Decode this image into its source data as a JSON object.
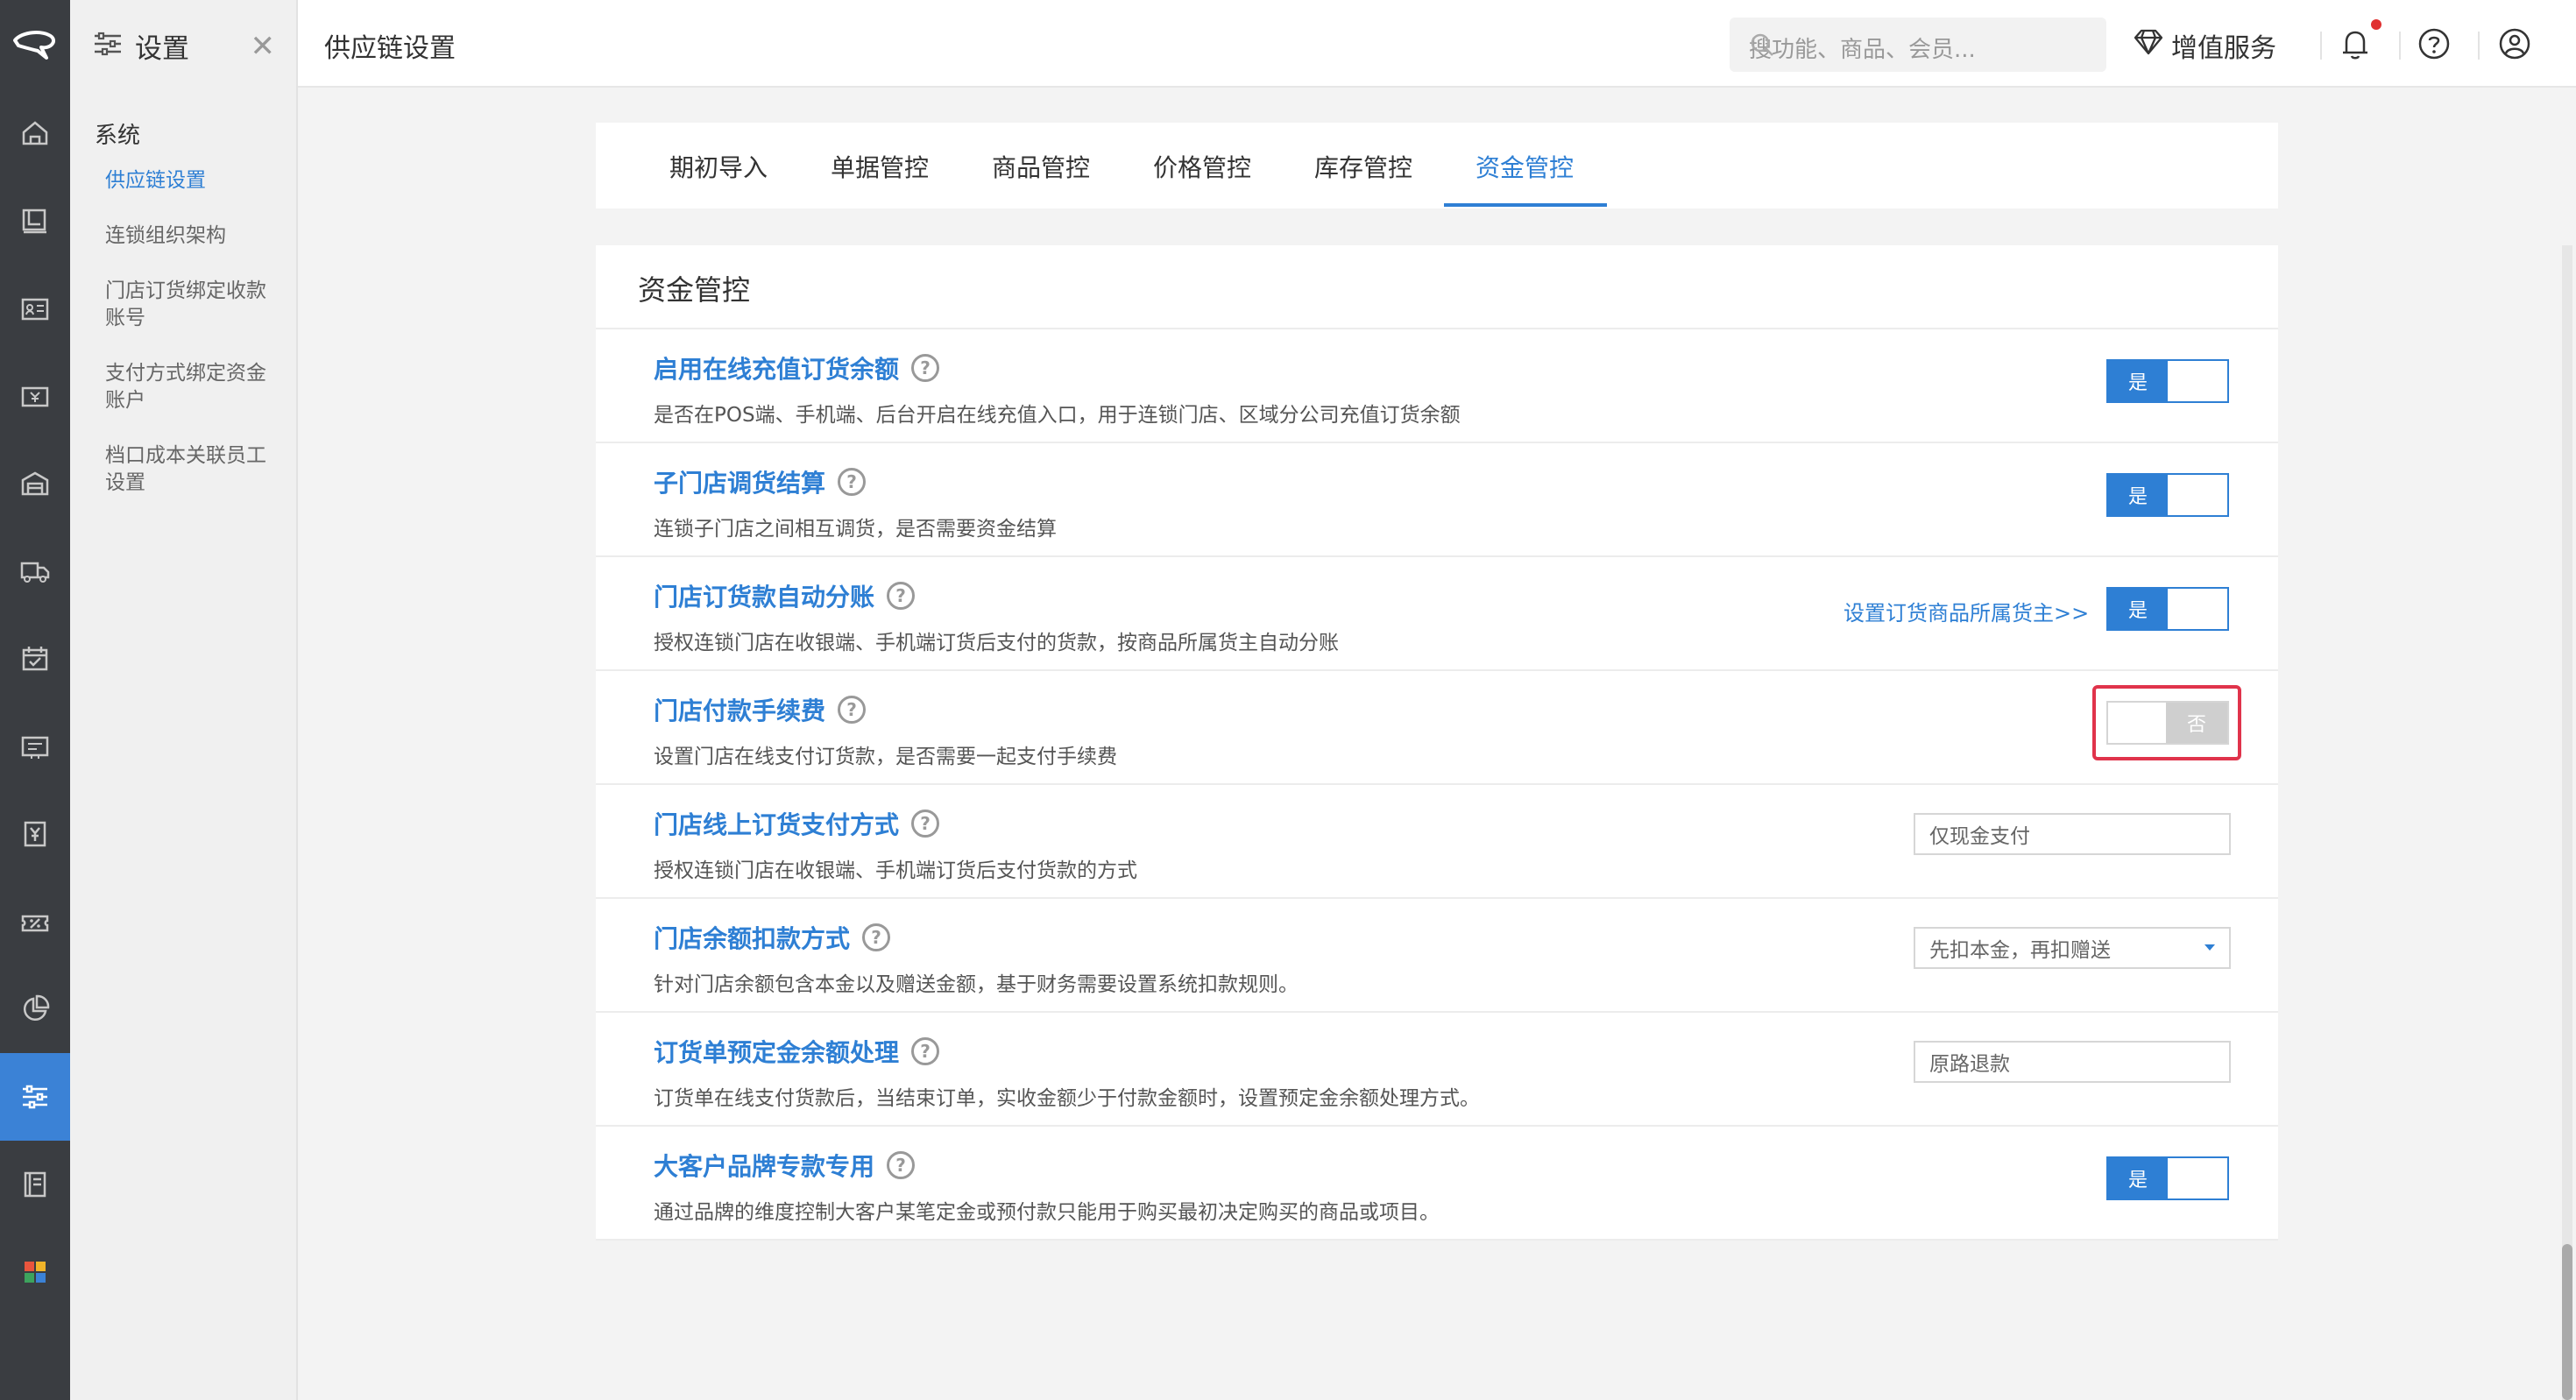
{
  "rail": {
    "items": [
      {
        "name": "home-icon"
      },
      {
        "name": "board-icon"
      },
      {
        "name": "member-card-icon"
      },
      {
        "name": "cashier-icon"
      },
      {
        "name": "warehouse-icon"
      },
      {
        "name": "delivery-truck-icon"
      },
      {
        "name": "calendar-check-icon"
      },
      {
        "name": "voucher-icon"
      },
      {
        "name": "finance-icon"
      },
      {
        "name": "discount-icon"
      },
      {
        "name": "report-pie-icon"
      },
      {
        "name": "settings-sliders-icon"
      },
      {
        "name": "book-icon"
      },
      {
        "name": "apps-grid-icon"
      }
    ],
    "active_index": 11,
    "accent": "#3b82d6"
  },
  "subnav": {
    "title": "设置",
    "section": "系统",
    "items": [
      {
        "label": "供应链设置",
        "active": true
      },
      {
        "label": "连锁组织架构"
      },
      {
        "label": "门店订货绑定收款账号"
      },
      {
        "label": "支付方式绑定资金账户"
      },
      {
        "label": "档口成本关联员工设置"
      }
    ]
  },
  "header": {
    "title": "供应链设置",
    "search_placeholder": "搜功能、商品、会员...",
    "value_added": "增值服务"
  },
  "tabs": {
    "items": [
      "期初导入",
      "单据管控",
      "商品管控",
      "价格管控",
      "库存管控",
      "资金管控"
    ],
    "active": "资金管控"
  },
  "card": {
    "title": "资金管控",
    "rows": [
      {
        "title": "启用在线充值订货余额",
        "desc": "是否在POS端、手机端、后台开启在线充值入口，用于连锁门店、区域分公司充值订货余额",
        "control": "toggle",
        "value": "是"
      },
      {
        "title": "子门店调货结算",
        "desc": "连锁子门店之间相互调货，是否需要资金结算",
        "control": "toggle",
        "value": "是"
      },
      {
        "title": "门店订货款自动分账",
        "desc": "授权连锁门店在收银端、手机端订货后支付的货款，按商品所属货主自动分账",
        "control": "toggle",
        "value": "是",
        "link": "设置订货商品所属货主>>"
      },
      {
        "title": "门店付款手续费",
        "desc": "设置门店在线支付订货款，是否需要一起支付手续费",
        "control": "toggle",
        "value": "否",
        "highlighted": true
      },
      {
        "title": "门店线上订货支付方式",
        "desc": "授权连锁门店在收银端、手机端订货后支付货款的方式",
        "control": "input",
        "value": "仅现金支付"
      },
      {
        "title": "门店余额扣款方式",
        "desc": "针对门店余额包含本金以及赠送金额，基于财务需要设置系统扣款规则。",
        "control": "select",
        "value": "先扣本金，再扣赠送"
      },
      {
        "title": "订货单预定金余额处理",
        "desc": "订货单在线支付货款后，当结束订单，实收金额少于付款金额时，设置预定金余额处理方式。",
        "control": "input",
        "value": "原路退款"
      },
      {
        "title": "大客户品牌专款专用",
        "desc": "通过品牌的维度控制大客户某笔定金或预付款只能用于购买最初决定购买的商品或项目。",
        "control": "toggle",
        "value": "是"
      }
    ]
  },
  "colors": {
    "primary": "#2e7fd4",
    "highlight": "#e0334b",
    "rail_bg": "#3a3d41"
  }
}
